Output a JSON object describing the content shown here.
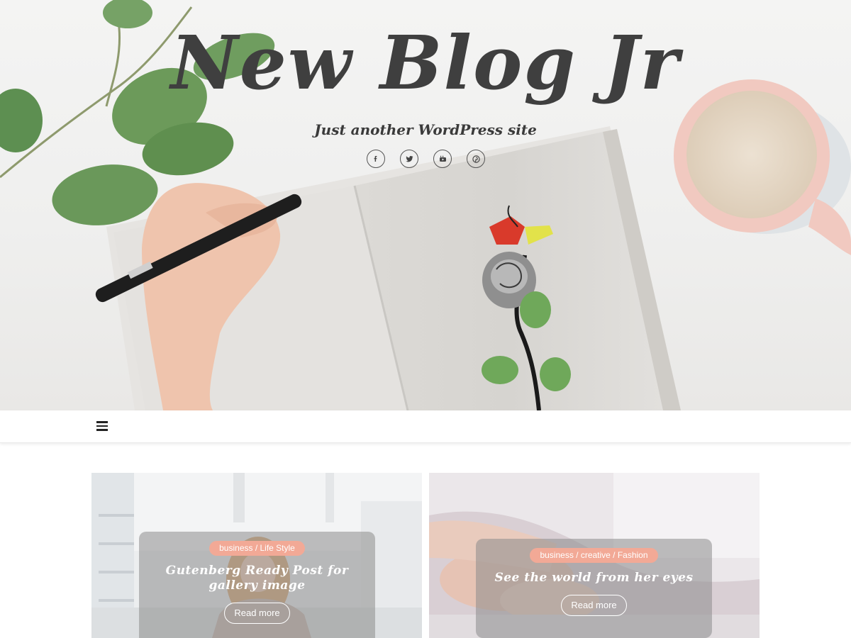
{
  "site": {
    "title": "New Blog Jr",
    "tagline": "Just another WordPress site"
  },
  "social": [
    {
      "name": "facebook",
      "glyph": "f",
      "icon": "facebook-icon"
    },
    {
      "name": "twitter",
      "glyph": "",
      "icon": "twitter-icon"
    },
    {
      "name": "youtube",
      "glyph": "",
      "icon": "youtube-icon"
    },
    {
      "name": "pinterest",
      "glyph": "",
      "icon": "pinterest-icon"
    }
  ],
  "nav": {
    "menu_icon": "hamburger-menu-icon"
  },
  "posts": [
    {
      "categories": "business / Life Style",
      "title": "Gutenberg Ready Post for gallery image",
      "read_more": "Read more"
    },
    {
      "categories": "business / creative / Fashion",
      "title": "See the world from her eyes",
      "read_more": "Read more"
    }
  ],
  "colors": {
    "accent_badge": "#f2a996",
    "title_text": "#3f3f3f",
    "overlay": "rgba(140,140,140,0.55)"
  }
}
